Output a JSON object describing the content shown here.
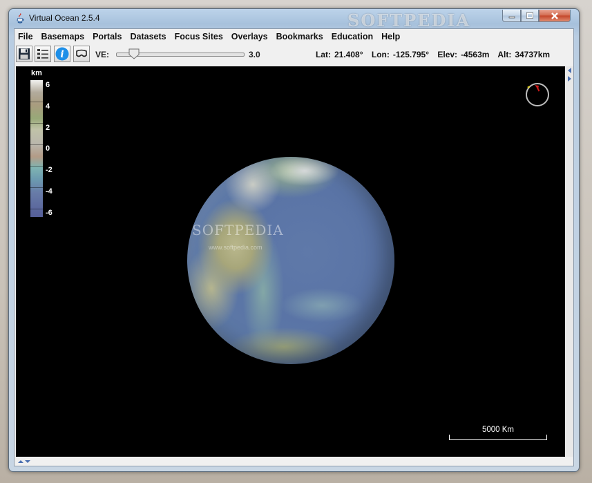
{
  "window": {
    "title": "Virtual Ocean 2.5.4",
    "watermark": "SOFTPEDIA"
  },
  "menu": [
    "File",
    "Basemaps",
    "Portals",
    "Datasets",
    "Focus Sites",
    "Overlays",
    "Bookmarks",
    "Education",
    "Help"
  ],
  "toolbar": {
    "ve_label": "VE:",
    "ve_value": "3.0",
    "ve_level": 0.1,
    "lat_label": "Lat:",
    "lat_value": "21.408°",
    "lon_label": "Lon:",
    "lon_value": "-125.795°",
    "elev_label": "Elev:",
    "elev_value": "-4563m",
    "alt_label": "Alt:",
    "alt_value": "34737km"
  },
  "elevation_key": {
    "unit": "km",
    "labels": [
      "6",
      "4",
      "2",
      "0",
      "-2",
      "-4",
      "-6"
    ]
  },
  "globe": {
    "watermark": "SOFTPEDIA",
    "watermark_sub": "www.softpedia.com"
  },
  "scalebar": {
    "label": "5000 Km"
  },
  "colors": {
    "view_bg": "#000000",
    "compass_needle": "#d11a1a",
    "compass_marker": "#e5d21a"
  }
}
